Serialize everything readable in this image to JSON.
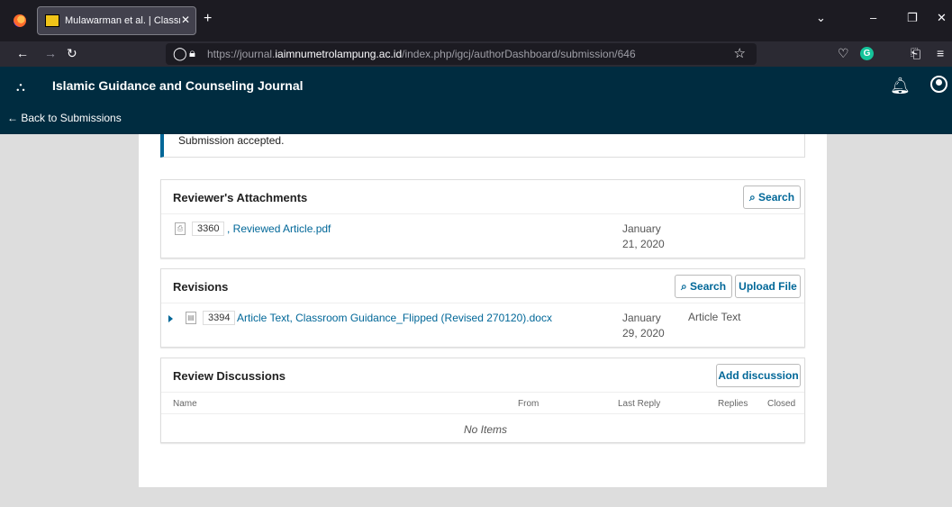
{
  "browser": {
    "tab_title": "Mulawarman et al. | Classroom",
    "url_prefix": "https://journal.",
    "url_domain": "iaimnumetrolampung.ac.id",
    "url_path": "/index.php/igcj/authorDashboard/submission/646",
    "g_label": "G"
  },
  "header": {
    "journal_title": "Islamic Guidance and Counseling Journal",
    "back_link": "← Back to Submissions"
  },
  "notice": {
    "text": "Submission accepted."
  },
  "reviewer_attachments": {
    "title": "Reviewer's Attachments",
    "search_label": "Search",
    "file": {
      "id": "3360",
      "name": ", Reviewed Article.pdf",
      "date_line1": "January",
      "date_line2": "21, 2020"
    }
  },
  "revisions": {
    "title": "Revisions",
    "search_label": "Search",
    "upload_label": "Upload File",
    "file": {
      "id": "3394",
      "name": "Article Text, Classroom Guidance_Flipped (Revised 270120).docx",
      "date_line1": "January",
      "date_line2": "29, 2020",
      "type": "Article Text"
    }
  },
  "review_discussions": {
    "title": "Review Discussions",
    "add_label": "Add discussion",
    "columns": {
      "name": "Name",
      "from": "From",
      "last_reply": "Last Reply",
      "replies": "Replies",
      "closed": "Closed"
    },
    "empty_text": "No Items"
  },
  "colors": {
    "header": "#002c40",
    "accent": "#006798"
  }
}
